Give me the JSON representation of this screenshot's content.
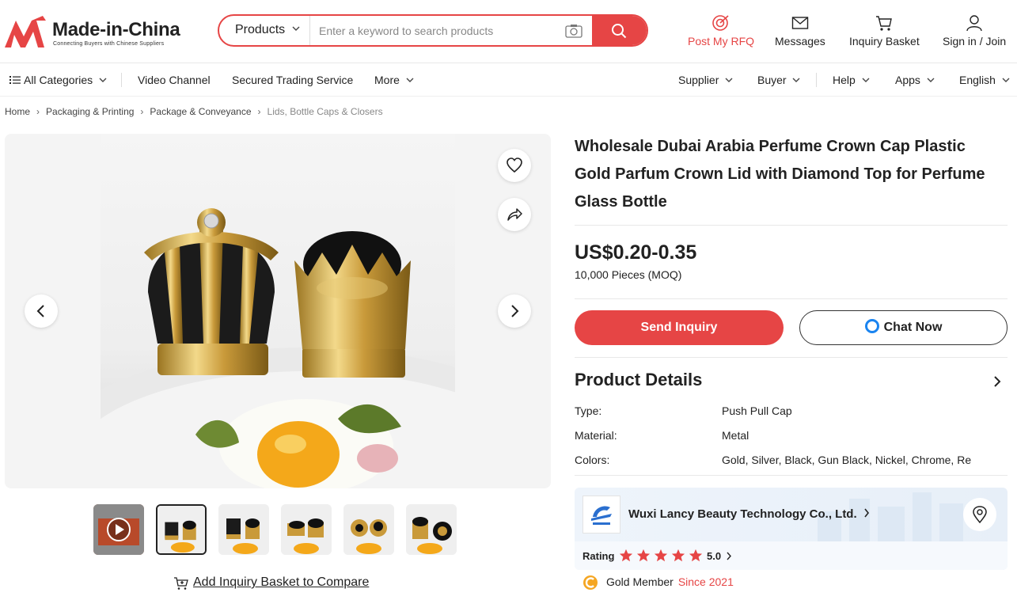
{
  "header": {
    "logo_text": "Made-in-China",
    "logo_sub": "Connecting Buyers with Chinese Suppliers",
    "search_category": "Products",
    "search_placeholder": "Enter a keyword to search products",
    "post_rfq": "Post My RFQ",
    "messages": "Messages",
    "inquiry_basket": "Inquiry Basket",
    "sign_in": "Sign in / Join"
  },
  "nav": {
    "all_categories": "All Categories",
    "video_channel": "Video Channel",
    "secured_trading": "Secured Trading Service",
    "more": "More",
    "supplier": "Supplier",
    "buyer": "Buyer",
    "help": "Help",
    "apps": "Apps",
    "language": "English"
  },
  "breadcrumb": [
    "Home",
    "Packaging & Printing",
    "Package & Conveyance",
    "Lids, Bottle Caps & Closers"
  ],
  "product": {
    "title": "Wholesale Dubai Arabia Perfume Crown Cap Plastic Gold Parfum Crown Lid with Diamond Top for Perfume Glass Bottle",
    "price": "US$0.20-0.35",
    "moq": "10,000 Pieces (MOQ)",
    "send_inquiry": "Send Inquiry",
    "chat_now": "Chat Now",
    "compare": "Add Inquiry Basket to Compare"
  },
  "details": {
    "heading": "Product Details",
    "rows": [
      {
        "label": "Type:",
        "value": "Push Pull Cap"
      },
      {
        "label": "Material:",
        "value": "Metal"
      },
      {
        "label": "Colors:",
        "value": "Gold, Silver, Black, Gun Black, Nickel, Chrome, Re"
      }
    ]
  },
  "supplier": {
    "name": "Wuxi Lancy Beauty Technology Co., Ltd.",
    "rating_label": "Rating",
    "rating_value": "5.0",
    "rating_stars": 5,
    "member": "Gold Member",
    "since": "Since 2021"
  },
  "colors": {
    "brand_red": "#e64545",
    "chat_blue": "#1a84f0"
  }
}
